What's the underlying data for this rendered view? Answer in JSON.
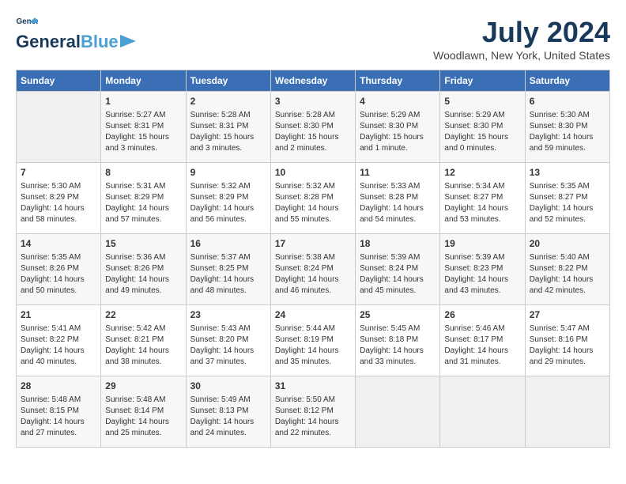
{
  "header": {
    "logo_line1": "General",
    "logo_line2": "Blue",
    "month_year": "July 2024",
    "location": "Woodlawn, New York, United States"
  },
  "days_of_week": [
    "Sunday",
    "Monday",
    "Tuesday",
    "Wednesday",
    "Thursday",
    "Friday",
    "Saturday"
  ],
  "weeks": [
    [
      {
        "day": "",
        "content": ""
      },
      {
        "day": "1",
        "content": "Sunrise: 5:27 AM\nSunset: 8:31 PM\nDaylight: 15 hours\nand 3 minutes."
      },
      {
        "day": "2",
        "content": "Sunrise: 5:28 AM\nSunset: 8:31 PM\nDaylight: 15 hours\nand 3 minutes."
      },
      {
        "day": "3",
        "content": "Sunrise: 5:28 AM\nSunset: 8:30 PM\nDaylight: 15 hours\nand 2 minutes."
      },
      {
        "day": "4",
        "content": "Sunrise: 5:29 AM\nSunset: 8:30 PM\nDaylight: 15 hours\nand 1 minute."
      },
      {
        "day": "5",
        "content": "Sunrise: 5:29 AM\nSunset: 8:30 PM\nDaylight: 15 hours\nand 0 minutes."
      },
      {
        "day": "6",
        "content": "Sunrise: 5:30 AM\nSunset: 8:30 PM\nDaylight: 14 hours\nand 59 minutes."
      }
    ],
    [
      {
        "day": "7",
        "content": "Sunrise: 5:30 AM\nSunset: 8:29 PM\nDaylight: 14 hours\nand 58 minutes."
      },
      {
        "day": "8",
        "content": "Sunrise: 5:31 AM\nSunset: 8:29 PM\nDaylight: 14 hours\nand 57 minutes."
      },
      {
        "day": "9",
        "content": "Sunrise: 5:32 AM\nSunset: 8:29 PM\nDaylight: 14 hours\nand 56 minutes."
      },
      {
        "day": "10",
        "content": "Sunrise: 5:32 AM\nSunset: 8:28 PM\nDaylight: 14 hours\nand 55 minutes."
      },
      {
        "day": "11",
        "content": "Sunrise: 5:33 AM\nSunset: 8:28 PM\nDaylight: 14 hours\nand 54 minutes."
      },
      {
        "day": "12",
        "content": "Sunrise: 5:34 AM\nSunset: 8:27 PM\nDaylight: 14 hours\nand 53 minutes."
      },
      {
        "day": "13",
        "content": "Sunrise: 5:35 AM\nSunset: 8:27 PM\nDaylight: 14 hours\nand 52 minutes."
      }
    ],
    [
      {
        "day": "14",
        "content": "Sunrise: 5:35 AM\nSunset: 8:26 PM\nDaylight: 14 hours\nand 50 minutes."
      },
      {
        "day": "15",
        "content": "Sunrise: 5:36 AM\nSunset: 8:26 PM\nDaylight: 14 hours\nand 49 minutes."
      },
      {
        "day": "16",
        "content": "Sunrise: 5:37 AM\nSunset: 8:25 PM\nDaylight: 14 hours\nand 48 minutes."
      },
      {
        "day": "17",
        "content": "Sunrise: 5:38 AM\nSunset: 8:24 PM\nDaylight: 14 hours\nand 46 minutes."
      },
      {
        "day": "18",
        "content": "Sunrise: 5:39 AM\nSunset: 8:24 PM\nDaylight: 14 hours\nand 45 minutes."
      },
      {
        "day": "19",
        "content": "Sunrise: 5:39 AM\nSunset: 8:23 PM\nDaylight: 14 hours\nand 43 minutes."
      },
      {
        "day": "20",
        "content": "Sunrise: 5:40 AM\nSunset: 8:22 PM\nDaylight: 14 hours\nand 42 minutes."
      }
    ],
    [
      {
        "day": "21",
        "content": "Sunrise: 5:41 AM\nSunset: 8:22 PM\nDaylight: 14 hours\nand 40 minutes."
      },
      {
        "day": "22",
        "content": "Sunrise: 5:42 AM\nSunset: 8:21 PM\nDaylight: 14 hours\nand 38 minutes."
      },
      {
        "day": "23",
        "content": "Sunrise: 5:43 AM\nSunset: 8:20 PM\nDaylight: 14 hours\nand 37 minutes."
      },
      {
        "day": "24",
        "content": "Sunrise: 5:44 AM\nSunset: 8:19 PM\nDaylight: 14 hours\nand 35 minutes."
      },
      {
        "day": "25",
        "content": "Sunrise: 5:45 AM\nSunset: 8:18 PM\nDaylight: 14 hours\nand 33 minutes."
      },
      {
        "day": "26",
        "content": "Sunrise: 5:46 AM\nSunset: 8:17 PM\nDaylight: 14 hours\nand 31 minutes."
      },
      {
        "day": "27",
        "content": "Sunrise: 5:47 AM\nSunset: 8:16 PM\nDaylight: 14 hours\nand 29 minutes."
      }
    ],
    [
      {
        "day": "28",
        "content": "Sunrise: 5:48 AM\nSunset: 8:15 PM\nDaylight: 14 hours\nand 27 minutes."
      },
      {
        "day": "29",
        "content": "Sunrise: 5:48 AM\nSunset: 8:14 PM\nDaylight: 14 hours\nand 25 minutes."
      },
      {
        "day": "30",
        "content": "Sunrise: 5:49 AM\nSunset: 8:13 PM\nDaylight: 14 hours\nand 24 minutes."
      },
      {
        "day": "31",
        "content": "Sunrise: 5:50 AM\nSunset: 8:12 PM\nDaylight: 14 hours\nand 22 minutes."
      },
      {
        "day": "",
        "content": ""
      },
      {
        "day": "",
        "content": ""
      },
      {
        "day": "",
        "content": ""
      }
    ]
  ]
}
